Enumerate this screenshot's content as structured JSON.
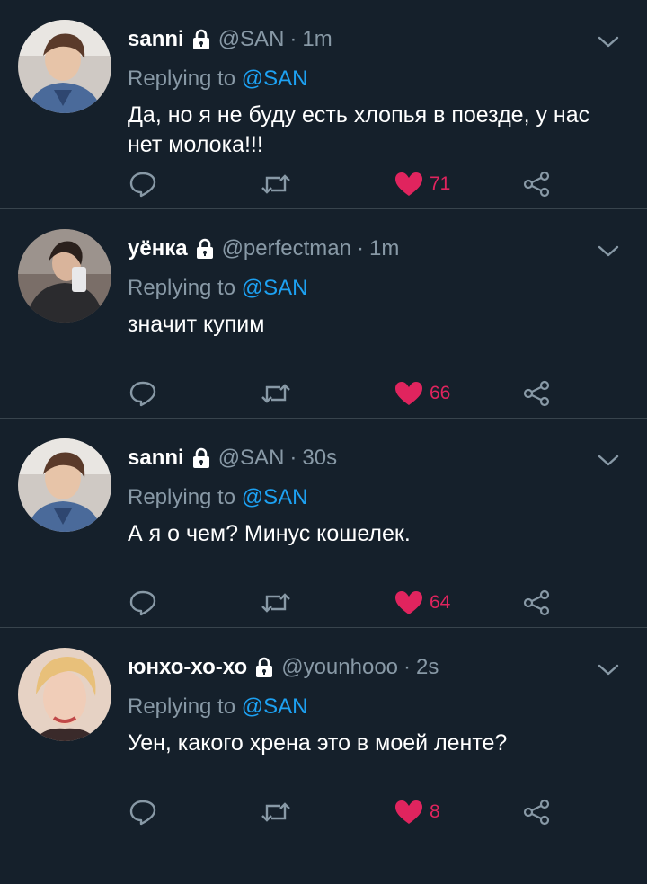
{
  "tweets": [
    {
      "name": "sanni",
      "handle": "@SAN",
      "time": "1m",
      "reply_prefix": "Replying to",
      "reply_to": "@SAN",
      "text": "Да, но я не буду есть хлопья в поезде, у нас нет молока!!!",
      "likes": "71"
    },
    {
      "name": "уёнка",
      "handle": "@perfectman",
      "time": "1m",
      "reply_prefix": "Replying to",
      "reply_to": "@SAN",
      "text": "значит купим",
      "likes": "66"
    },
    {
      "name": "sanni",
      "handle": "@SAN",
      "time": "30s",
      "reply_prefix": "Replying to",
      "reply_to": "@SAN",
      "text": "А я о чем? Минус кошелек.",
      "likes": "64"
    },
    {
      "name": "юнхо-хо-хо",
      "handle": "@younhooo",
      "time": "2s",
      "reply_prefix": "Replying to",
      "reply_to": "@SAN",
      "text": "Уен, какого хрена это в моей ленте?",
      "likes": "8"
    }
  ],
  "separator": "·",
  "icons": {
    "lock": "lock-icon",
    "caret": "chevron-down-icon",
    "reply": "reply-icon",
    "retweet": "retweet-icon",
    "like": "heart-icon",
    "share": "share-icon"
  },
  "colors": {
    "background": "#15202b",
    "secondary_text": "#8899a6",
    "mention": "#1da1f2",
    "like": "#e0245e",
    "divider": "#38444d"
  }
}
